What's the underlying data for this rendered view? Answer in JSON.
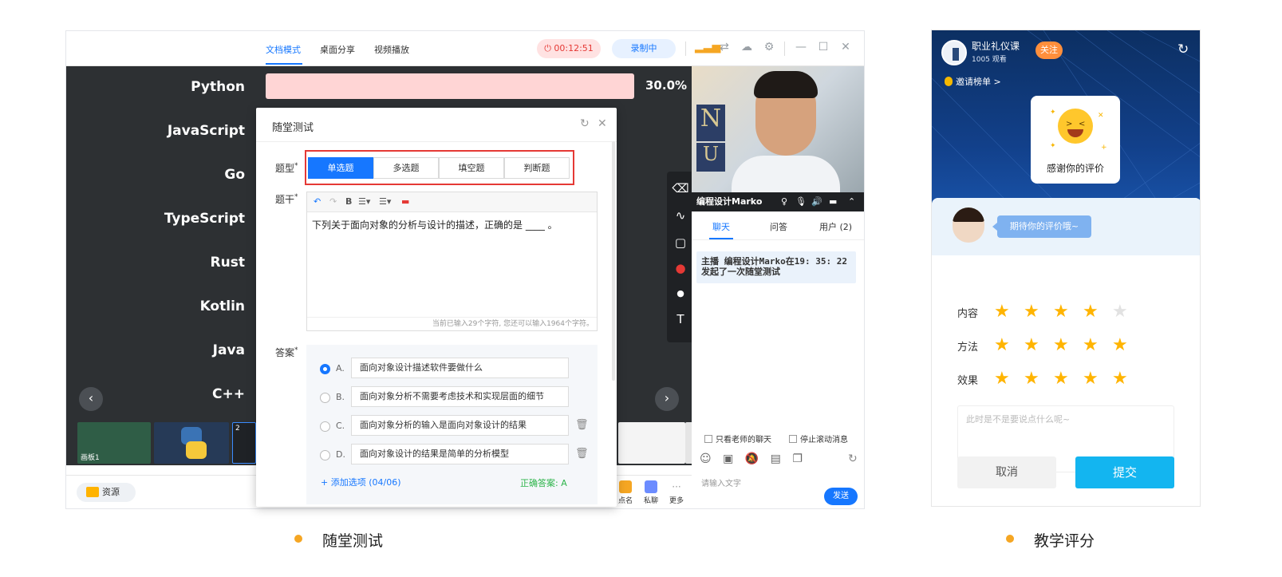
{
  "app": {
    "modes": [
      "文档模式",
      "桌面分享",
      "视频播放"
    ],
    "timer": "00:12:51",
    "recording": "录制中"
  },
  "stage": {
    "languages": [
      "Python",
      "JavaScript",
      "Go",
      "TypeScript",
      "Rust",
      "Kotlin",
      "Java",
      "C++"
    ],
    "python_percent": "30.0%",
    "python_fraction": 0.3,
    "thumb_label": "画板1",
    "thumb_page": "2"
  },
  "bottombar": {
    "resource": "资源",
    "items": [
      "点名",
      "私聊",
      "更多"
    ]
  },
  "video": {
    "presenter": "编程设计Marko"
  },
  "chat": {
    "tabs": [
      "聊天",
      "问答",
      "用户 (2)"
    ],
    "message": "主播 编程设计Marko在19: 35: 22 发起了一次随堂测试",
    "only_teacher": "只看老师的聊天",
    "stop_scroll": "停止滚动消息",
    "input_placeholder": "请输入文字",
    "send": "发送"
  },
  "quiz": {
    "title": "随堂测试",
    "type_label": "题型",
    "types": [
      "单选题",
      "多选题",
      "填空题",
      "判断题"
    ],
    "stem_label": "题干",
    "stem_text": "下列关于面向对象的分析与设计的描述，正确的是 ____ 。",
    "char_count": "当前已输入29个字符, 您还可以输入1964个字符。",
    "answer_label": "答案",
    "options": [
      {
        "letter": "A.",
        "text": "面向对象设计描述软件要做什么"
      },
      {
        "letter": "B.",
        "text": "面向对象分析不需要考虑技术和实现层面的细节"
      },
      {
        "letter": "C.",
        "text": "面向对象分析的输入是面向对象设计的结果"
      },
      {
        "letter": "D.",
        "text": "面向对象设计的结果是简单的分析模型"
      }
    ],
    "add_option": "+ 添加选项 (04/06)",
    "correct_answer": "正确答案: A"
  },
  "mobile": {
    "course_name": "职业礼仪课",
    "views": "1005 观看",
    "follow": "关注",
    "invite": "邀请榜单 >",
    "thanks": "感谢你的评价",
    "bubble": "期待你的评价哦~",
    "ratings": [
      {
        "label": "内容",
        "stars": 4
      },
      {
        "label": "方法",
        "stars": 5
      },
      {
        "label": "效果",
        "stars": 5
      }
    ],
    "comment_placeholder": "此时是不是要说点什么呢~",
    "cancel": "取消",
    "submit": "提交"
  },
  "captions": {
    "left": "随堂测试",
    "right": "教学评分"
  },
  "colors": {
    "accent": "#1677ff",
    "star": "#ffb400",
    "submit": "#13b5f0",
    "caption_dot": "#f5a623"
  }
}
